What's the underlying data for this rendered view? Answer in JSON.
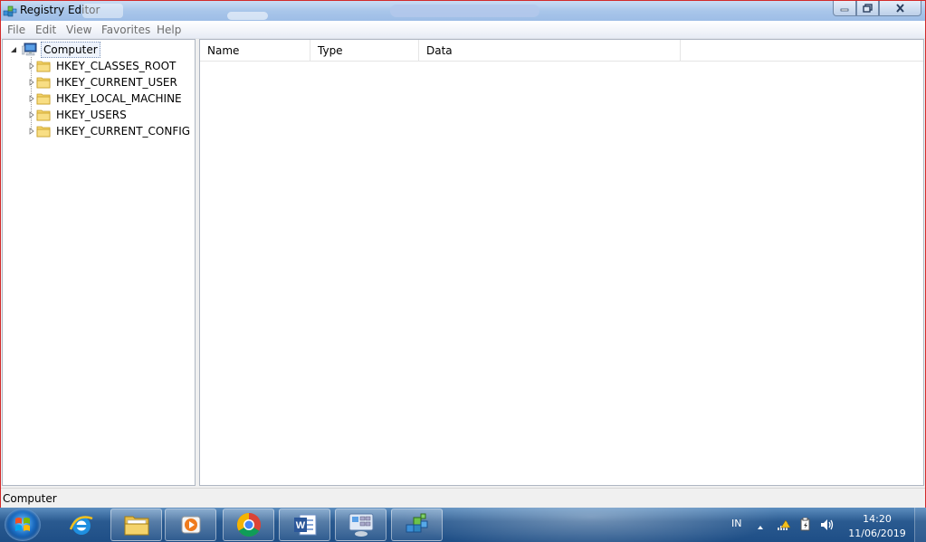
{
  "window": {
    "title": "Registry Editor",
    "caption_buttons": [
      "minimize",
      "restore",
      "close"
    ]
  },
  "menu": [
    {
      "label": "File"
    },
    {
      "label": "Edit"
    },
    {
      "label": "View"
    },
    {
      "label": "Favorites"
    },
    {
      "label": "Help"
    }
  ],
  "tree": {
    "root": {
      "label": "Computer",
      "icon": "computer-icon",
      "expanded": true
    },
    "children": [
      {
        "label": "HKEY_CLASSES_ROOT",
        "icon": "folder-icon"
      },
      {
        "label": "HKEY_CURRENT_USER",
        "icon": "folder-icon"
      },
      {
        "label": "HKEY_LOCAL_MACHINE",
        "icon": "folder-icon"
      },
      {
        "label": "HKEY_USERS",
        "icon": "folder-icon"
      },
      {
        "label": "HKEY_CURRENT_CONFIG",
        "icon": "folder-icon"
      }
    ]
  },
  "list": {
    "columns": [
      {
        "label": "Name"
      },
      {
        "label": "Type"
      },
      {
        "label": "Data"
      }
    ],
    "rows": []
  },
  "status": {
    "path": "Computer"
  },
  "taskbar": {
    "apps": [
      {
        "name": "windows-explorer",
        "icon": "folder-icon",
        "state": "pinned"
      },
      {
        "name": "internet-explorer",
        "icon": "ie-icon",
        "state": "pinned"
      },
      {
        "name": "windows-media-player",
        "icon": "media-player-icon",
        "state": "pinned"
      },
      {
        "name": "chrome",
        "icon": "chrome-icon",
        "state": "pinned"
      },
      {
        "name": "word",
        "icon": "word-icon",
        "state": "running"
      },
      {
        "name": "control-panel",
        "icon": "control-panel-icon",
        "state": "running"
      },
      {
        "name": "registry-editor",
        "icon": "regedit-icon",
        "state": "running-active"
      }
    ],
    "tray": {
      "language": "IN",
      "icons": [
        "show-hidden-icons",
        "network-icon",
        "power-icon",
        "volume-icon"
      ]
    },
    "clock": {
      "time": "14:20",
      "date": "11/06/2019"
    }
  },
  "colors": {
    "window_border": "#d22a2a",
    "titlebar": "#a9c6ea",
    "taskbar": "#1e4e86"
  }
}
